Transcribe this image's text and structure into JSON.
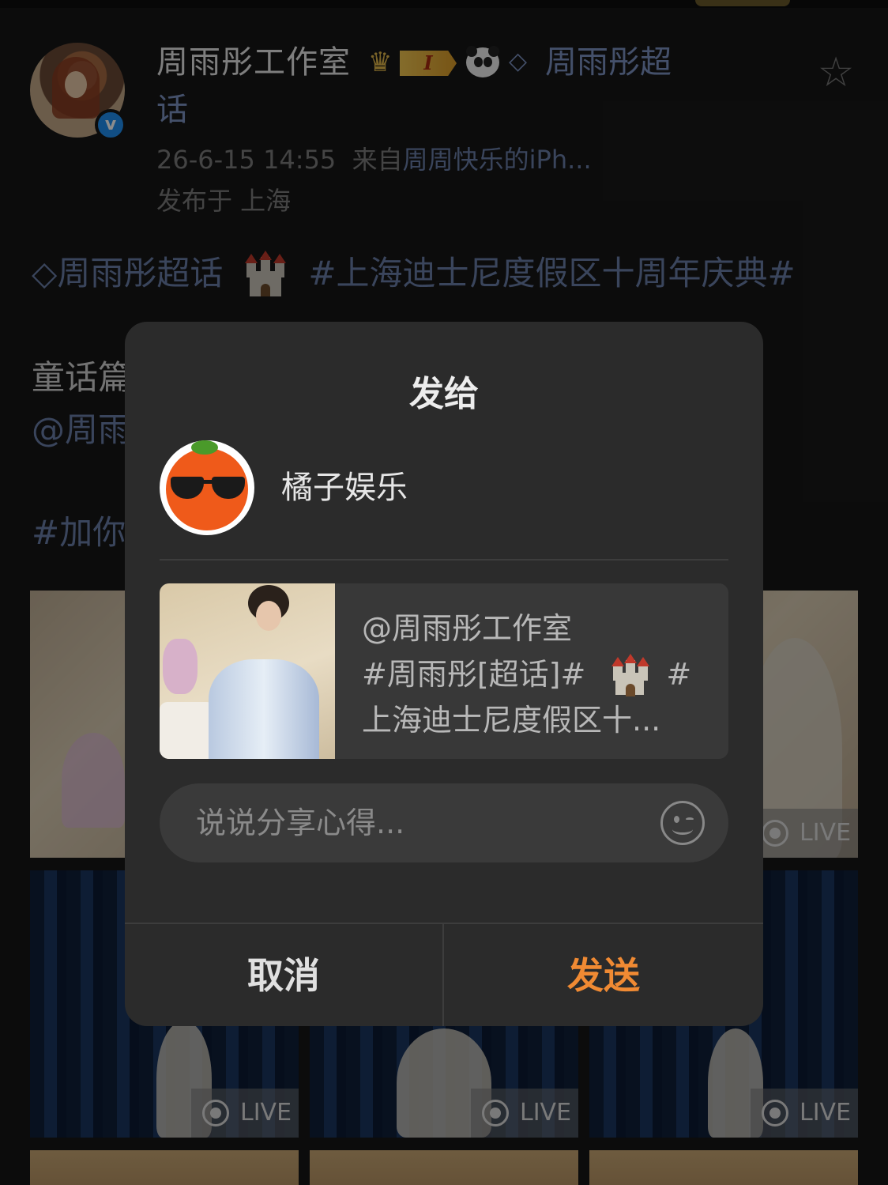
{
  "post": {
    "author_name": "周雨彤工作室",
    "level_badge": "I",
    "supertopic_link_part1": "周雨彤超",
    "supertopic_link_part2": "话",
    "timestamp": "26-6-15 14:55",
    "source_prefix": "来自",
    "source": "周周快乐的iPh...",
    "location": "发布于 上海",
    "topic_supertopic": "周雨彤超话",
    "topic_hashtag": "#上海迪士尼度假区十周年庆典#",
    "text_fragment_1": "童话篇",
    "text_fragment_2": "@周雨",
    "text_fragment_3": "#加你",
    "live_label": "LIVE"
  },
  "dialog": {
    "title": "发给",
    "recipient": {
      "name": "橘子娱乐"
    },
    "preview": {
      "line1": "@周雨彤工作室",
      "line2_tag": "#周雨彤[超话]#",
      "line2_end": "#",
      "line3": "上海迪士尼度假区十..."
    },
    "comment": {
      "placeholder": "说说分享心得...",
      "value": ""
    },
    "cancel_label": "取消",
    "send_label": "发送"
  },
  "colors": {
    "accent": "#f08a33",
    "link": "#7d92c2",
    "dialog_bg": "#2b2b2b",
    "verified": "#1f8ff0"
  }
}
